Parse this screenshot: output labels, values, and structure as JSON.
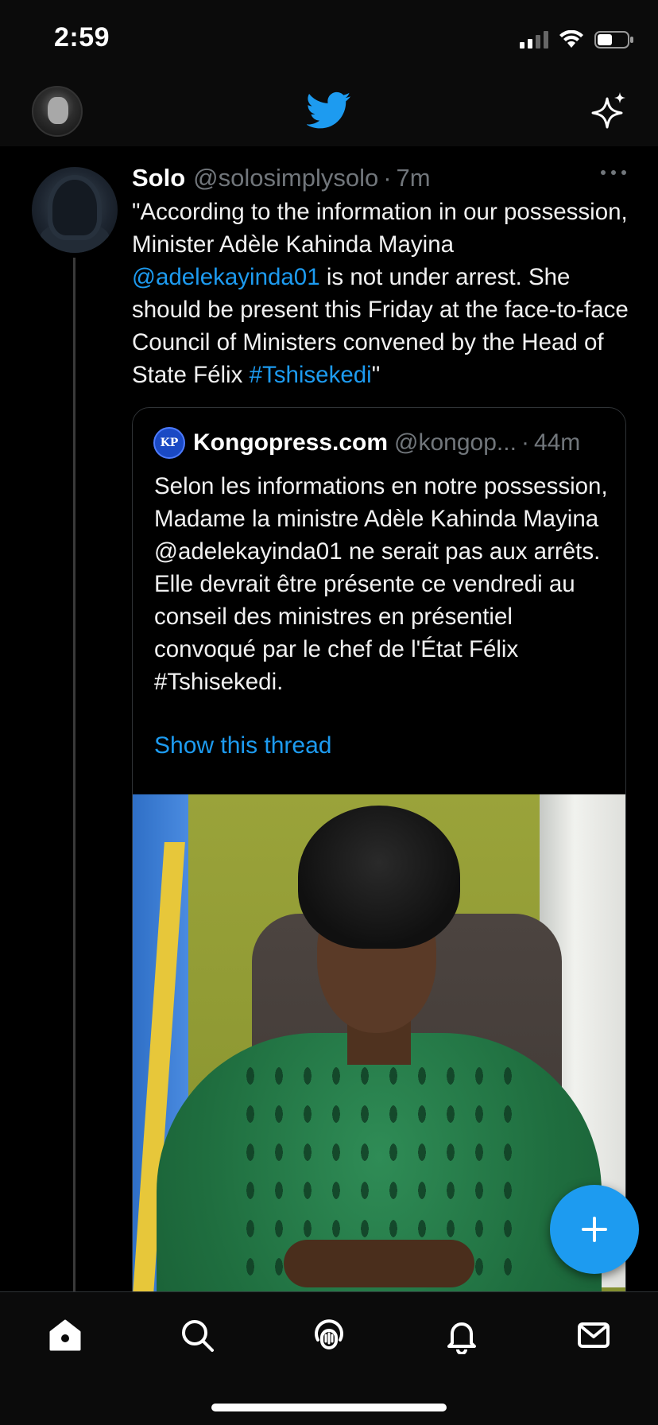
{
  "status_bar": {
    "time": "2:59"
  },
  "tweet": {
    "name": "Solo",
    "handle": "@solosimplysolo",
    "separator": "·",
    "time": "7m",
    "text_part1": "\"According to the information in our possession, Minister Adèle Kahinda Mayina ",
    "mention": "@adelekayinda01",
    "text_part2": " is not under arrest. She should be present this Friday at the face-to-face Council of Ministers convened by the Head of State Félix ",
    "hashtag": "#Tshisekedi",
    "text_part3": "\""
  },
  "quote": {
    "logo_text": "KP",
    "name": "Kongopress.com",
    "handle": "@kongop...",
    "separator": "·",
    "time": "44m",
    "text": "Selon les informations en notre possession, Madame la ministre Adèle Kahinda Mayina @adelekayinda01 ne serait pas aux arrêts.\nElle devrait être présente ce vendredi au conseil des ministres en présentiel convoqué par le chef de l'État Félix #Tshisekedi.",
    "show_thread": "Show this thread"
  },
  "colors": {
    "accent": "#1d9bf0",
    "background": "#000000",
    "muted_text": "#71767b"
  },
  "icons": {
    "header": [
      "profile-avatar",
      "twitter-bird-icon",
      "sparkle-icon"
    ],
    "bottom_nav": [
      "home-icon",
      "search-icon",
      "spaces-icon",
      "notifications-icon",
      "messages-icon"
    ],
    "fab": "plus-icon"
  }
}
